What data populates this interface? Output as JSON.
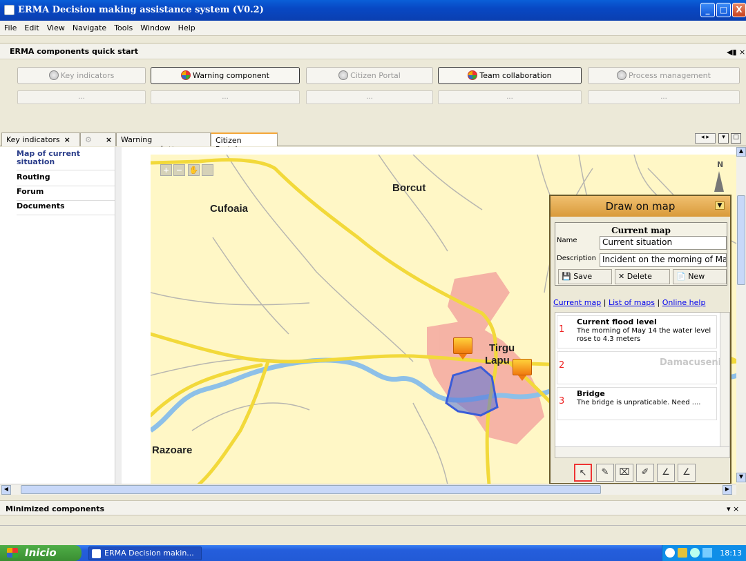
{
  "window": {
    "title": "ERMA Decision making assistance system (V0.2)",
    "min": "_",
    "max": "□",
    "close": "X"
  },
  "menu": [
    "File",
    "Edit",
    "View",
    "Navigate",
    "Tools",
    "Window",
    "Help"
  ],
  "quickstart": {
    "title": "ERMA components quick start",
    "controls": "◀▮ ×",
    "buttons": [
      {
        "label": "Key indicators",
        "active": false
      },
      {
        "label": "Warning component",
        "active": true
      },
      {
        "label": "Citizen Portal",
        "active": false
      },
      {
        "label": "Team collaboration",
        "active": true
      },
      {
        "label": "Process management",
        "active": false
      }
    ],
    "subbuttons": [
      "...",
      "...",
      "...",
      "...",
      "..."
    ]
  },
  "tabs": [
    {
      "label": "Key indicators",
      "close": "×"
    },
    {
      "label": "",
      "close": "×"
    },
    {
      "label": "Warning component",
      "close": "×"
    },
    {
      "label": "Citizen Portal",
      "close": "×"
    }
  ],
  "sidebar": {
    "items": [
      "Map of current situation",
      "Routing",
      "Forum",
      "Documents"
    ]
  },
  "map": {
    "places": [
      "Borcut",
      "Cufoaia",
      "Tirgu",
      "Lapu",
      "Damacuseni",
      "Razoare"
    ],
    "north": "N",
    "zoom_in": "+",
    "zoom_out": "−"
  },
  "draw_panel": {
    "title": "Draw on map",
    "current_map_heading": "Current map",
    "name_label": "Name",
    "name_value": "Current situation",
    "description_label": "Description",
    "description_value": "Incident on the morning of May",
    "save": "Save",
    "delete": "Delete",
    "new": "New",
    "links": {
      "current": "Current map",
      "list": "List of maps",
      "help": "Online help",
      "sep": "|"
    },
    "items": [
      {
        "num": "1",
        "title": "Current flood level",
        "desc": "The morning of May 14 the water level rose to 4.3 meters"
      },
      {
        "num": "2",
        "title": "",
        "desc": ""
      },
      {
        "num": "3",
        "title": "Bridge",
        "desc": "The bridge is unpraticable. Need ...."
      }
    ]
  },
  "minimized": {
    "title": "Minimized components",
    "controls": "▾ ×"
  },
  "taskbar": {
    "start": "Inicio",
    "item": "ERMA Decision makin...",
    "clock": "18:13"
  },
  "colors": {
    "titlebar": "#0A5FD8",
    "map_bg": "#FFF7C6",
    "road": "#F2D93A",
    "river": "#8DC0E8",
    "town": "#F4A8A0",
    "polygon": "#5070D8",
    "draw_header": "#E6AE55"
  }
}
